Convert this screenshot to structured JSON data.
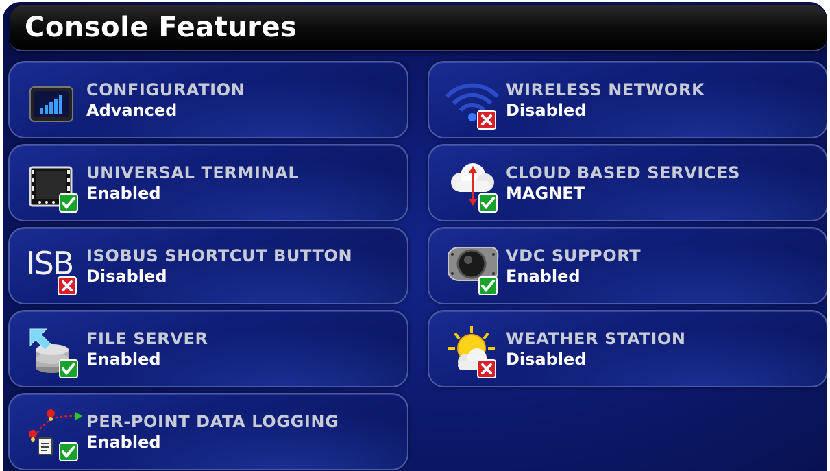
{
  "header": {
    "title": "Console Features"
  },
  "colors": {
    "background": "#0c1a6e",
    "tile": "#132486",
    "tile_border": "#4a5aa8",
    "label": "#c7cbd6",
    "value": "#ffffff",
    "enabled_badge": "#1aa32a",
    "disabled_badge": "#d8202a"
  },
  "features": [
    {
      "label": "CONFIGURATION",
      "value": "Advanced",
      "icon": "configuration-icon",
      "status": "none"
    },
    {
      "label": "UNIVERSAL TERMINAL",
      "value": "Enabled",
      "icon": "universal-terminal-icon",
      "status": "enabled"
    },
    {
      "label": "ISOBUS SHORTCUT BUTTON",
      "value": "Disabled",
      "icon": "isb-icon",
      "icon_text": "ISB",
      "status": "disabled"
    },
    {
      "label": "FILE SERVER",
      "value": "Enabled",
      "icon": "file-server-icon",
      "status": "enabled"
    },
    {
      "label": "PER-POINT DATA LOGGING",
      "value": "Enabled",
      "icon": "data-logging-icon",
      "status": "enabled"
    },
    {
      "label": "WIRELESS NETWORK",
      "value": "Disabled",
      "icon": "wireless-icon",
      "status": "disabled"
    },
    {
      "label": "CLOUD BASED SERVICES",
      "value": "MAGNET",
      "icon": "cloud-icon",
      "status": "enabled"
    },
    {
      "label": "VDC SUPPORT",
      "value": "Enabled",
      "icon": "vdc-icon",
      "status": "enabled"
    },
    {
      "label": "WEATHER STATION",
      "value": "Disabled",
      "icon": "weather-icon",
      "status": "disabled"
    }
  ]
}
